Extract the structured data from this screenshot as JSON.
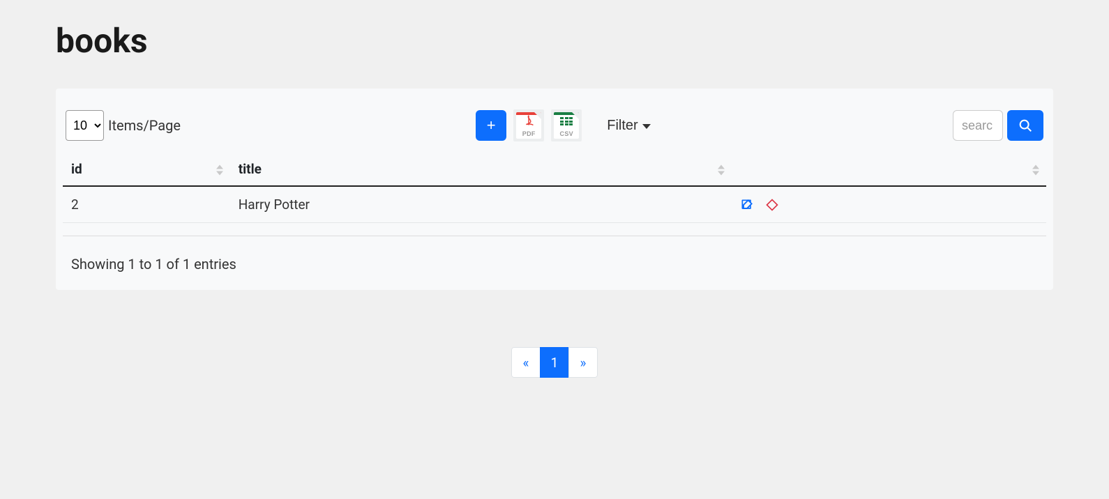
{
  "page": {
    "title": "books"
  },
  "toolbar": {
    "items_per_page_value": "10",
    "items_per_page_label": "Items/Page",
    "add_label": "+",
    "pdf_label": "PDF",
    "csv_label": "CSV",
    "filter_label": "Filter",
    "search_placeholder": "searc",
    "search_value": ""
  },
  "table": {
    "columns": {
      "id": "id",
      "title": "title"
    },
    "rows": [
      {
        "id": "2",
        "title": "Harry Potter"
      }
    ]
  },
  "footer": {
    "showing_text": "Showing 1 to 1 of 1 entries"
  },
  "pagination": {
    "prev": "«",
    "next": "»",
    "pages": [
      "1"
    ],
    "active_index": 0
  }
}
